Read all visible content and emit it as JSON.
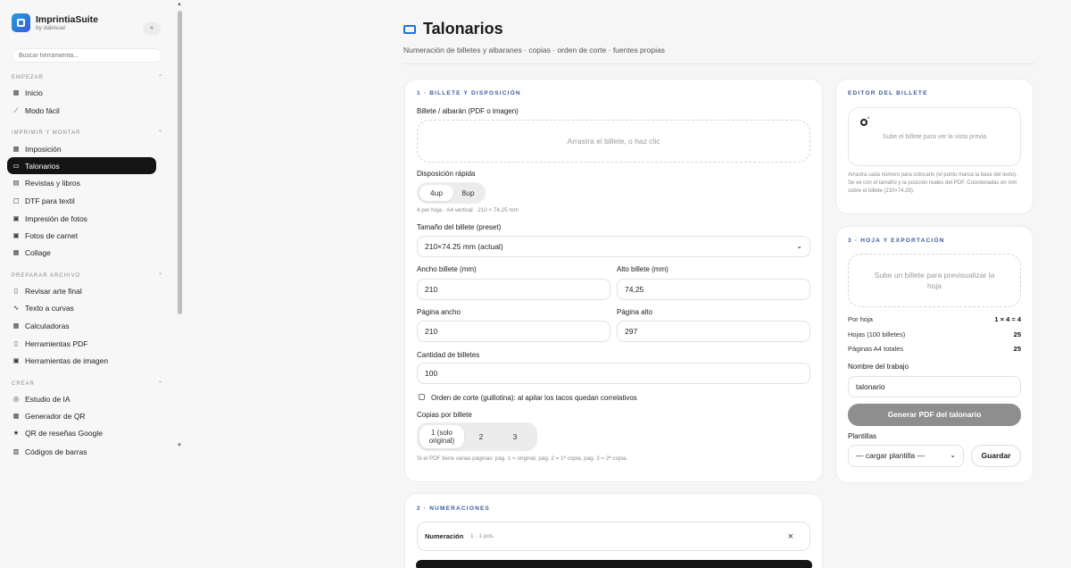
{
  "brand": {
    "name": "ImprintiaSuite",
    "sub": "by dabisual"
  },
  "sidebar": {
    "collapse_label": "«",
    "search_placeholder": "Buscar herramienta...",
    "sections": [
      {
        "title": "EMPEZAR",
        "items": [
          {
            "label": "Inicio",
            "icon": "grid-icon"
          },
          {
            "label": "Modo fácil",
            "icon": "wand-icon"
          }
        ]
      },
      {
        "title": "IMPRIMIR Y MONTAR",
        "items": [
          {
            "label": "Imposición",
            "icon": "grid-icon"
          },
          {
            "label": "Talonarios",
            "icon": "ticket-icon"
          },
          {
            "label": "Revistas y libros",
            "icon": "book-icon"
          },
          {
            "label": "DTF para textil",
            "icon": "shirt-icon"
          },
          {
            "label": "Impresión de fotos",
            "icon": "image-icon"
          },
          {
            "label": "Fotos de carnet",
            "icon": "id-icon"
          },
          {
            "label": "Collage",
            "icon": "collage-icon"
          }
        ]
      },
      {
        "title": "PREPARAR ARCHIVO",
        "items": [
          {
            "label": "Revisar arte final",
            "icon": "file-check-icon"
          },
          {
            "label": "Texto a curvas",
            "icon": "curve-icon"
          },
          {
            "label": "Calculadoras",
            "icon": "calculator-icon"
          },
          {
            "label": "Herramientas PDF",
            "icon": "pdf-icon"
          },
          {
            "label": "Herramientas de imagen",
            "icon": "image-tools-icon"
          }
        ]
      },
      {
        "title": "CREAR",
        "items": [
          {
            "label": "Estudio de IA",
            "icon": "ai-icon"
          },
          {
            "label": "Generador de QR",
            "icon": "qr-icon"
          },
          {
            "label": "QR de reseñas Google",
            "icon": "star-icon"
          },
          {
            "label": "Códigos de barras",
            "icon": "barcode-icon"
          }
        ]
      }
    ],
    "active_item": "Talonarios"
  },
  "header": {
    "title": "Talonarios",
    "subtitle": "Numeración de billetes y albaranes · copias · orden de corte · fuentes propias"
  },
  "section1": {
    "head": "1 · BILLETE Y DISPOSICIÓN",
    "upload_label": "Billete / albarán (PDF o imagen)",
    "upload_drop": "Arrastra el billete, o haz clic",
    "layout_label": "Disposición rápida",
    "layout_options": [
      "4up",
      "8up"
    ],
    "layout_selected": "4up",
    "layout_hint": "4 por hoja · A4 vertical · 210 × 74,25 mm",
    "preset_label": "Tamaño del billete (preset)",
    "preset_value": "210×74.25 mm (actual)",
    "width_label": "Ancho billete (mm)",
    "width_value": "210",
    "height_label": "Alto billete (mm)",
    "height_value": "74,25",
    "page_w_label": "Página ancho",
    "page_w_value": "210",
    "page_h_label": "Página alto",
    "page_h_value": "297",
    "qty_label": "Cantidad de billetes",
    "qty_value": "100",
    "cut_order_label": "Orden de corte (guillotina): al apilar los tacos quedan correlativos",
    "copies_label": "Copias por billete",
    "copies_options": [
      "1 (solo original)",
      "2",
      "3"
    ],
    "copies_selected": "1 (solo original)",
    "copies_hint": "Si el PDF tiene varias páginas: pág. 1 = original, pág. 2 = 1ª copia, pág. 3 = 2ª copia."
  },
  "section2": {
    "head": "2 · NUMERACIONES",
    "numeracion_label": "Numeración",
    "numeracion_meta": "1 · 1 pos.",
    "close_label": "×"
  },
  "editor": {
    "head": "EDITOR DEL BILLETE",
    "preview_text": "Sube el billete para ver la vista previa",
    "radio_label": "º",
    "hint": "Arrastra cada número para colocarlo (el punto marca la base del texto). Se ve con el tamaño y la posición reales del PDF. Coordenadas en mm sobre el billete (210×74.25)."
  },
  "export": {
    "head": "3 · HOJA Y EXPORTACIÓN",
    "preview_text": "Sube un billete para previsualizar la hoja",
    "stats": [
      {
        "label": "Por hoja",
        "value": "1 × 4 = 4"
      },
      {
        "label": "Hojas (100 billetes)",
        "value": "25"
      },
      {
        "label": "Páginas A4 totales",
        "value": "25"
      }
    ],
    "job_label": "Nombre del trabajo",
    "job_value": "talonario",
    "generate_label": "Generar PDF del talonario",
    "templates_label": "Plantillas",
    "templates_value": "— cargar plantilla —",
    "save_label": "Guardar"
  }
}
